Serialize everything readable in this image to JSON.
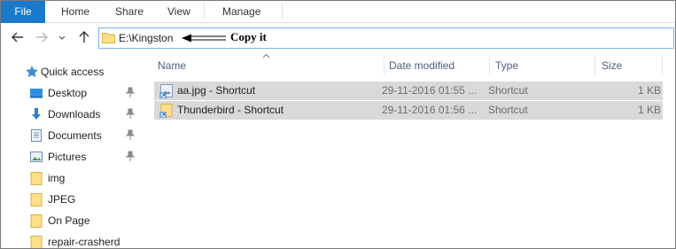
{
  "ribbon": {
    "tabs": [
      "File",
      "Home",
      "Share",
      "View",
      "Manage"
    ]
  },
  "address": {
    "path": "E:\\Kingston",
    "annotation": "Copy it"
  },
  "nav_pane": {
    "items": [
      {
        "label": "Quick access",
        "icon": "star-icon",
        "pinned": false
      },
      {
        "label": "Desktop",
        "icon": "desktop-icon",
        "pinned": true
      },
      {
        "label": "Downloads",
        "icon": "download-icon",
        "pinned": true
      },
      {
        "label": "Documents",
        "icon": "documents-icon",
        "pinned": true
      },
      {
        "label": "Pictures",
        "icon": "pictures-icon",
        "pinned": true
      },
      {
        "label": "img",
        "icon": "folder-icon",
        "pinned": false
      },
      {
        "label": "JPEG",
        "icon": "folder-icon",
        "pinned": false
      },
      {
        "label": "On Page",
        "icon": "folder-icon",
        "pinned": false
      },
      {
        "label": "repair-crasherd",
        "icon": "folder-icon",
        "pinned": false
      }
    ]
  },
  "file_list": {
    "columns": [
      "Name",
      "Date modified",
      "Type",
      "Size"
    ],
    "rows": [
      {
        "name": "aa.jpg - Shortcut",
        "date": "29-11-2016 01:55 ...",
        "type": "Shortcut",
        "size": "1 KB",
        "icon": "image-shortcut-icon"
      },
      {
        "name": "Thunderbird - Shortcut",
        "date": "29-11-2016 01:56 ...",
        "type": "Shortcut",
        "size": "1 KB",
        "icon": "folder-shortcut-icon"
      }
    ]
  },
  "colors": {
    "file_tab": "#1979ca",
    "selection": "#d9d9d9",
    "address_border": "#7eb4ea"
  }
}
